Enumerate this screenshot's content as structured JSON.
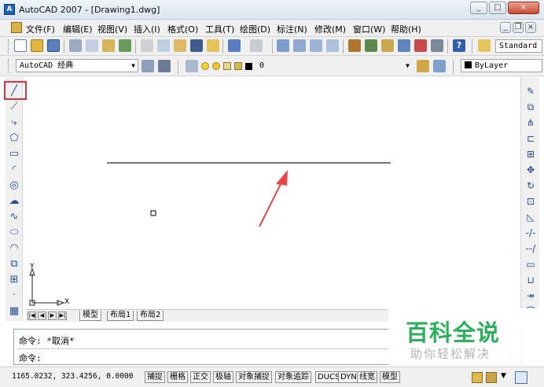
{
  "window": {
    "title": "AutoCAD 2007 - [Drawing1.dwg]",
    "icon_text": "A",
    "minimize": "_",
    "maximize": "□",
    "close": "×"
  },
  "menu": {
    "items": [
      "文件(F)",
      "编辑(E)",
      "视图(V)",
      "插入(I)",
      "格式(O)",
      "工具(T)",
      "绘图(D)",
      "标注(N)",
      "修改(M)",
      "窗口(W)",
      "帮助(H)"
    ],
    "mdi_minimize": "_",
    "mdi_restore": "❐",
    "mdi_close": "×"
  },
  "toolbar": {
    "text_style": "Standard",
    "workspace": "AutoCAD 经典",
    "layer": "0",
    "color": "ByLayer"
  },
  "drawing": {
    "ucs_x": "X",
    "ucs_y": "Y"
  },
  "tabs": {
    "nav": [
      "|◀",
      "◀",
      "▶",
      "▶|"
    ],
    "items": [
      "模型",
      "布局1",
      "布局2"
    ]
  },
  "command": {
    "line1": "命令: *取消*",
    "line2": "命令:"
  },
  "status": {
    "coords": "1165.0232, 323.4256, 0.0000",
    "buttons": [
      "捕捉",
      "栅格",
      "正交",
      "极轴",
      "对象捕捉",
      "对象追踪",
      "DUCS",
      "DYN",
      "线宽",
      "模型"
    ]
  },
  "watermark": {
    "title": "百科全说",
    "subtitle": "助你轻松解决"
  },
  "colors": {
    "highlight": "#e0303a",
    "arrow": "#e8454a",
    "watermark_green": "#2bb05c"
  }
}
